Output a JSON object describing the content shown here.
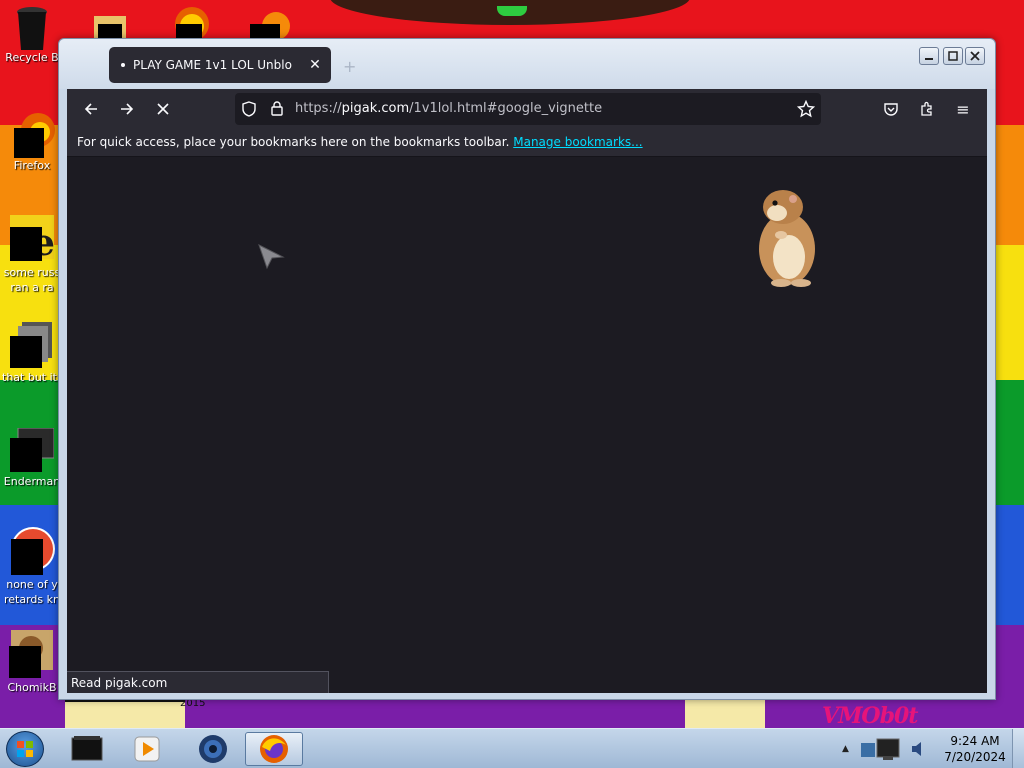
{
  "desktop": {
    "icons": [
      {
        "label": "Recycle B",
        "icon": "recycle-bin-icon"
      },
      {
        "label": "Firefox",
        "icon": "firefox-icon"
      },
      {
        "label_line1": "some russ",
        "label_line2": "ran a ra",
        "icon": "ie-icon"
      },
      {
        "label": "that but its",
        "icon": "folder-icon"
      },
      {
        "label": "Enderman",
        "icon": "terminal-icon"
      },
      {
        "label_line1": "none of y",
        "label_line2": "retards kn",
        "icon": "chrome-icon"
      },
      {
        "label": "ChomikB",
        "icon": "hamster-icon"
      }
    ],
    "wallpaper_caption": "2015",
    "wallpaper_brand": "VMOb0t"
  },
  "browser": {
    "tab": {
      "title": "PLAY GAME 1v1 LOL Unblo",
      "close_glyph": "✕"
    },
    "new_tab_glyph": "+",
    "url": {
      "scheme": "https://",
      "host": "pigak.com",
      "path": "/1v1lol.html#google_vignette"
    },
    "bookmarks_bar": {
      "message": "For quick access, place your bookmarks here on the bookmarks toolbar.",
      "link": "Manage bookmarks..."
    },
    "status": "Read pigak.com",
    "nav": {
      "back": "←",
      "forward": "→",
      "stop": "✕"
    },
    "menu_glyph": "≡"
  },
  "taskbar": {
    "time": "9:24 AM",
    "date": "7/20/2024",
    "items": [
      "cmd-icon",
      "media-player-icon",
      "app-icon",
      "firefox-icon"
    ]
  },
  "colors": {
    "firefox_dark": "#2b2a33",
    "content_bg": "#1c1b22",
    "link": "#00ddff"
  }
}
